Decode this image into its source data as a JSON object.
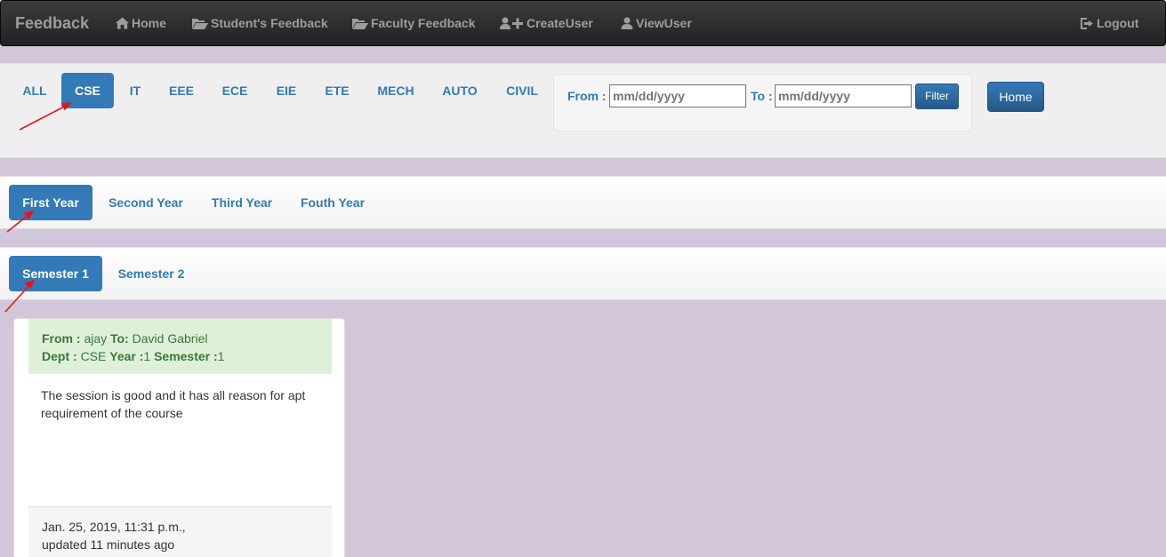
{
  "navbar": {
    "brand": "Feedback",
    "links": [
      {
        "label": "Home",
        "icon": "home-icon"
      },
      {
        "label": "Student's Feedback",
        "icon": "folder-open-icon"
      },
      {
        "label": "Faculty Feedback",
        "icon": "folder-open-icon"
      },
      {
        "label": "CreateUser",
        "icon": "user-plus-icon"
      },
      {
        "label": "ViewUser",
        "icon": "user-icon"
      }
    ],
    "logout": {
      "label": "Logout",
      "icon": "logout-icon"
    }
  },
  "departments": {
    "items": [
      "ALL",
      "CSE",
      "IT",
      "EEE",
      "ECE",
      "EIE",
      "ETE",
      "MECH",
      "AUTO",
      "CIVIL"
    ],
    "active": "CSE"
  },
  "date_filter": {
    "from_label": "From :",
    "from_placeholder": "mm/dd/yyyy",
    "to_label": "To :",
    "to_placeholder": "mm/dd/yyyy",
    "filter_button": "Filter"
  },
  "home_button": "Home",
  "years": {
    "items": [
      "First Year",
      "Second Year",
      "Third Year",
      "Fouth Year"
    ],
    "active": "First Year"
  },
  "semesters": {
    "items": [
      "Semester 1",
      "Semester 2"
    ],
    "active": "Semester 1"
  },
  "feedback_card": {
    "from_label": "From :",
    "from_value": "ajay",
    "to_label": "To:",
    "to_value": "David Gabriel",
    "dept_label": "Dept :",
    "dept_value": "CSE",
    "year_label": "Year :",
    "year_value": "1",
    "semester_label": "Semester :",
    "semester_value": "1",
    "body": "The session is good and it has all reason for apt requirement of the course",
    "timestamp": "Jan. 25, 2019, 11:31 p.m.,",
    "updated": "updated 11 minutes ago"
  },
  "colors": {
    "accent": "#337ab7",
    "annotation_arrow": "#e8141b",
    "background": "#d1c6da"
  }
}
